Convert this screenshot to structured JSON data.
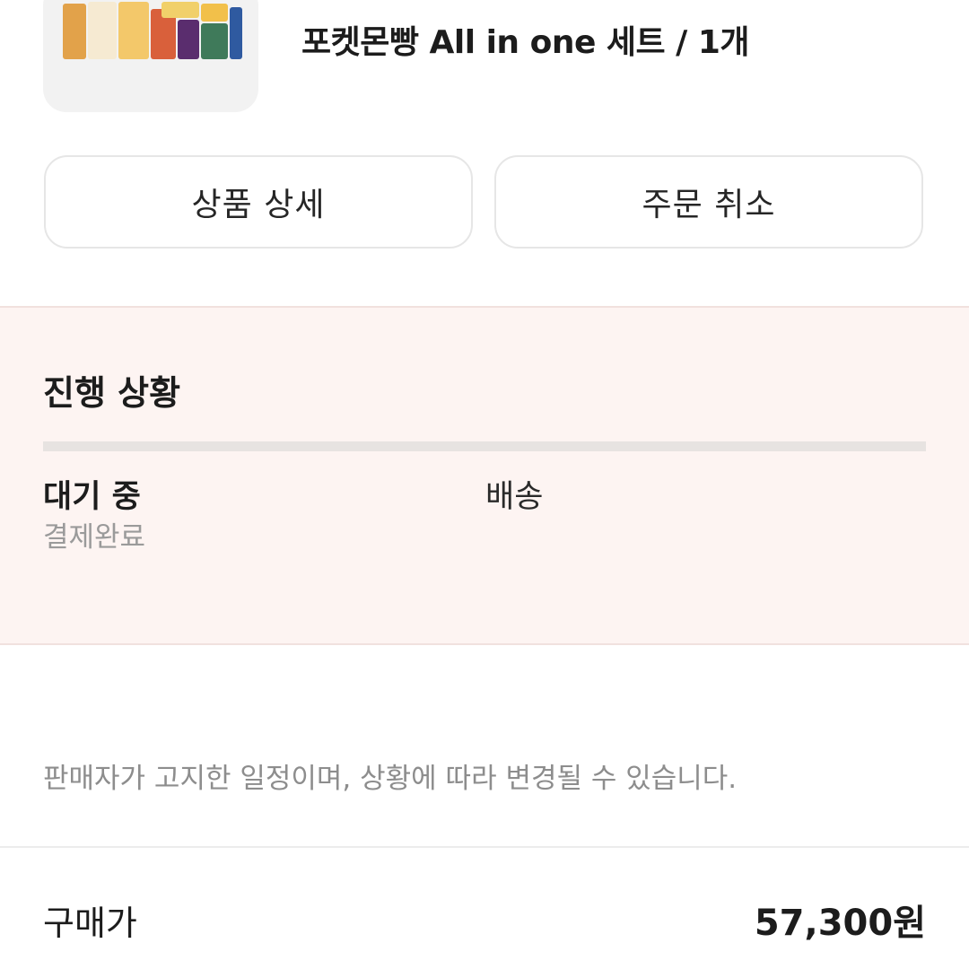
{
  "product": {
    "title": "포켓몬빵 All in one 세트 / 1개",
    "image_icon": "product-package-image"
  },
  "actions": {
    "detail_label": "상품 상세",
    "cancel_label": "주문 취소"
  },
  "progress": {
    "heading": "진행 상황",
    "steps": [
      {
        "label": "대기 중",
        "sub": "결제완료"
      },
      {
        "label": "배송",
        "sub": ""
      }
    ]
  },
  "notice": "판매자가 고지한 일정이며, 상황에 따라 변경될 수 있습니다.",
  "price": {
    "label": "구매가",
    "value": "57,300원"
  },
  "colors": {
    "progress_bg": "#fdf4f2",
    "progress_track": "#e7e3e1",
    "muted_text": "#9a9a9a"
  }
}
